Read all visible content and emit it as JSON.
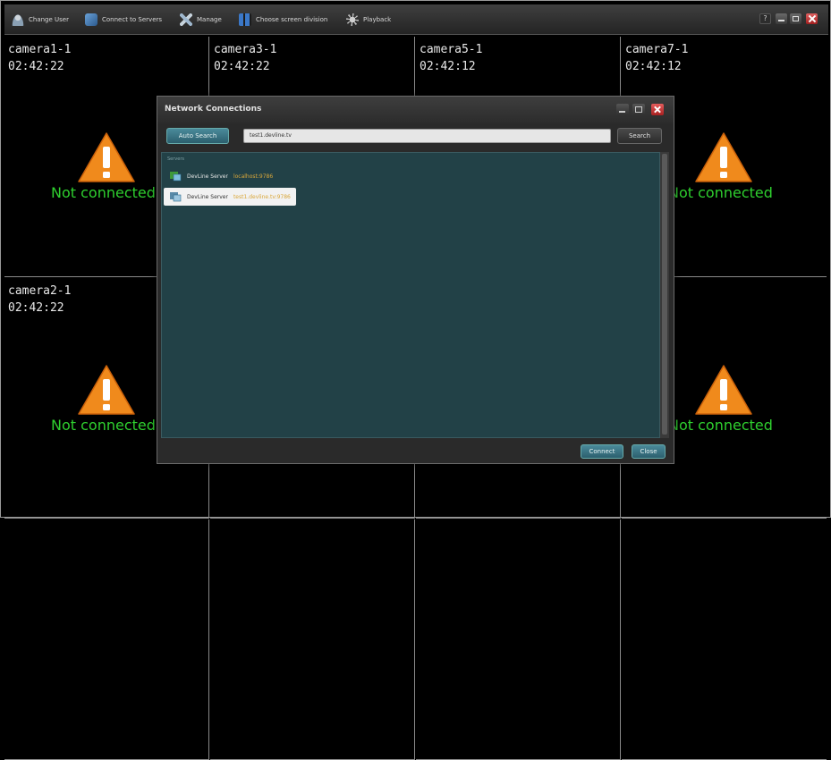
{
  "toolbar": {
    "items": [
      {
        "label": "Change User",
        "icon": "user-icon"
      },
      {
        "label": "Connect to Servers",
        "icon": "connect-icon"
      },
      {
        "label": "Manage",
        "icon": "manage-icon"
      },
      {
        "label": "Choose screen division",
        "icon": "split-screen-icon"
      },
      {
        "label": "Playback",
        "icon": "playback-icon"
      }
    ],
    "help_label": "?"
  },
  "cameras": [
    {
      "name": "camera1-1",
      "time": "02:42:22",
      "status": "Not connected"
    },
    {
      "name": "camera3-1",
      "time": "02:42:22",
      "status": ""
    },
    {
      "name": "camera5-1",
      "time": "02:42:12",
      "status": ""
    },
    {
      "name": "camera7-1",
      "time": "02:42:12",
      "status": "Not connected"
    },
    {
      "name": "camera2-1",
      "time": "02:42:22",
      "status": "Not connected"
    },
    {
      "name": "",
      "time": "",
      "status": ""
    },
    {
      "name": "",
      "time": "",
      "status": ""
    },
    {
      "name": "8-1",
      "time": "12",
      "status": "Not connected"
    },
    {
      "name": "",
      "time": "",
      "status": ""
    },
    {
      "name": "",
      "time": "",
      "status": ""
    },
    {
      "name": "",
      "time": "",
      "status": ""
    },
    {
      "name": "",
      "time": "",
      "status": ""
    }
  ],
  "dialog": {
    "title": "Network Connections",
    "auto_search_label": "Auto Search",
    "search_value": "test1.devline.tv",
    "search_button_label": "Search",
    "list_header": "Servers",
    "servers": [
      {
        "name": "DevLine Server",
        "address": "localhost:9786",
        "selected": false
      },
      {
        "name": "DevLine Server",
        "address": "test1.devline.tv:9786",
        "selected": true
      }
    ],
    "connect_label": "Connect",
    "close_label": "Close"
  },
  "colors": {
    "status_text": "#2fd02f",
    "warning_orange": "#f08a1c",
    "accent_teal": "#2c5f6e",
    "list_background": "#224147"
  }
}
